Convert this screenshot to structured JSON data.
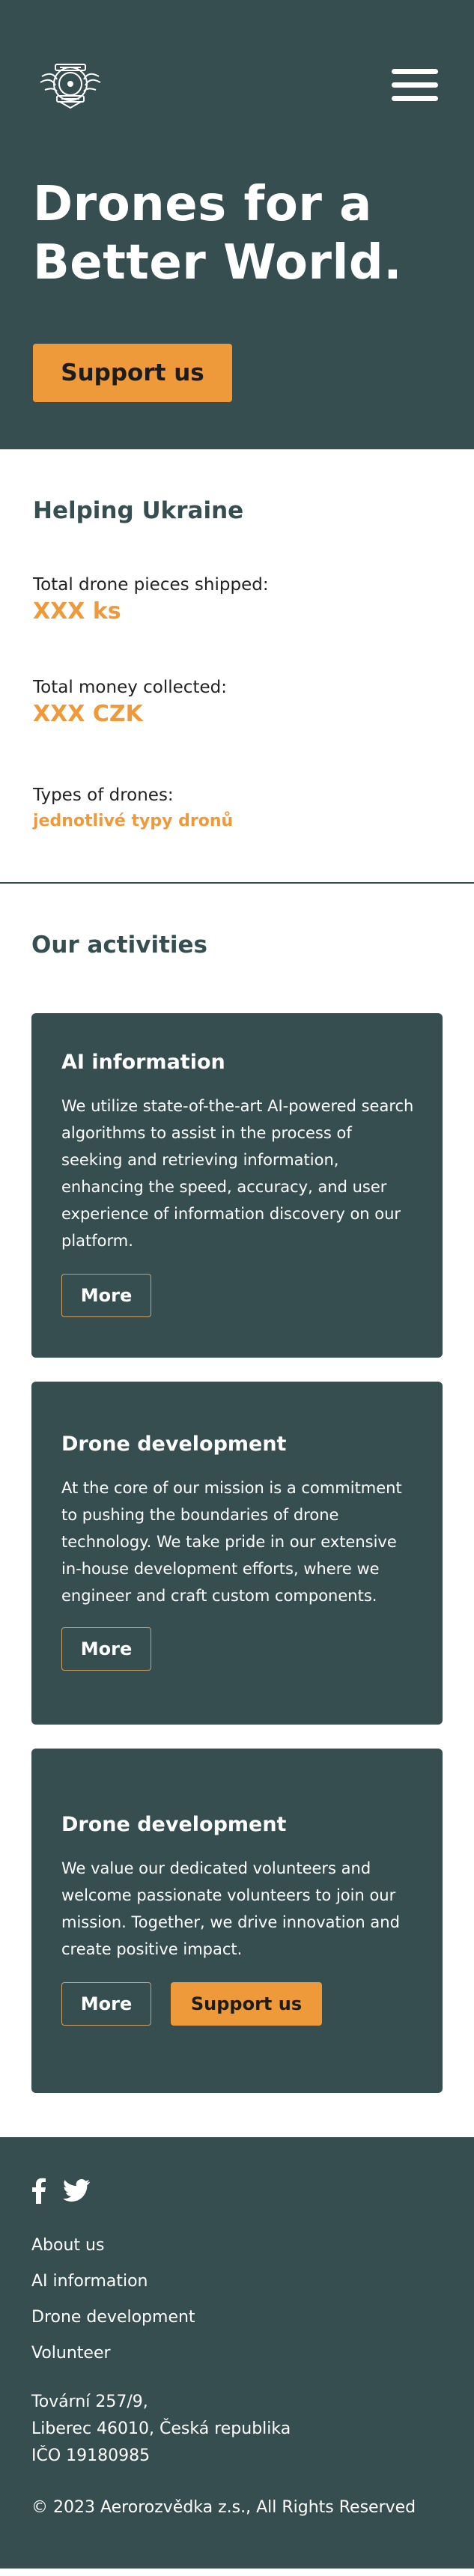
{
  "header": {
    "logo_icon": "drone-association-emblem-icon",
    "menu_icon": "hamburger-menu-icon",
    "title_line1": "Drones for a",
    "title_line2": "Better World.",
    "cta_label": "Support us"
  },
  "helping": {
    "title": "Helping Ukraine",
    "stats": [
      {
        "label": "Total drone pieces shipped:",
        "value": "XXX ks"
      },
      {
        "label": "Total money collected:",
        "value": "XXX CZK"
      },
      {
        "label": "Types of drones:",
        "value": "jednotlivé typy dronů"
      }
    ]
  },
  "activities": {
    "title": "Our activities",
    "cards": [
      {
        "title": "AI information",
        "text": "We utilize state-of-the-art AI-powered search algorithms to assist in the process of seeking and retrieving information, enhancing the speed, accuracy, and user experience of information discovery on our platform.",
        "more_label": "More"
      },
      {
        "title": "Drone development",
        "text": "At the core of our mission is a commitment to pushing the boundaries of drone technology. We take pride in our extensive in-house development efforts, where we engineer and craft custom components.",
        "more_label": "More"
      },
      {
        "title": "Drone development",
        "text": "We value our dedicated volunteers and welcome passionate volunteers to join our mission. Together, we drive innovation and create positive impact.",
        "more_label": "More",
        "support_label": "Support us"
      }
    ]
  },
  "footer": {
    "social": [
      "facebook-icon",
      "twitter-icon"
    ],
    "links": [
      "About us",
      "AI information",
      "Drone development",
      "Volunteer"
    ],
    "address_line1": "Tovární 257/9,",
    "address_line2": "Liberec 46010, Česká republika",
    "ico": "IČO 19180985",
    "copyright": "© 2023 Aerorozvědka z.s., All Rights Reserved"
  },
  "colors": {
    "primary": "#364e50",
    "accent": "#ef9a3a",
    "background": "#ffffff"
  }
}
